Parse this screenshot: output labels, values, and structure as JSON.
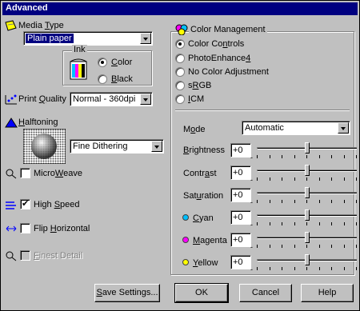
{
  "window": {
    "title": "Advanced"
  },
  "media_type": {
    "label_pre": "Media ",
    "label_ul": "T",
    "label_post": "ype",
    "selected": "Plain paper"
  },
  "ink": {
    "legend": "Ink",
    "options": [
      {
        "pre": "",
        "ul": "C",
        "post": "olor",
        "selected": true
      },
      {
        "pre": "",
        "ul": "B",
        "post": "lack",
        "selected": false
      }
    ]
  },
  "print_quality": {
    "label_pre": "Print ",
    "label_ul": "Q",
    "label_post": "uality",
    "selected": "Normal - 360dpi"
  },
  "halftoning": {
    "label_pre": "",
    "label_ul": "H",
    "label_post": "alftoning",
    "selected": "Fine Dithering"
  },
  "checkboxes": [
    {
      "pre": "Micro",
      "ul": "W",
      "post": "eave",
      "checked": false,
      "disabled": false
    },
    {
      "pre": "High ",
      "ul": "S",
      "post": "peed",
      "checked": true,
      "disabled": false
    },
    {
      "pre": "Flip ",
      "ul": "H",
      "post": "orizontal",
      "checked": false,
      "disabled": false
    },
    {
      "pre": "",
      "ul": "F",
      "post": "inest Detail",
      "checked": false,
      "disabled": true
    }
  ],
  "color_management": {
    "legend": "Color Management",
    "options": [
      {
        "pre": "Color Co",
        "ul": "n",
        "post": "trols",
        "selected": true
      },
      {
        "pre": "PhotoEnhance",
        "ul": "4",
        "post": "",
        "selected": false
      },
      {
        "pre": "No Color Adjustment",
        "ul": "",
        "post": "",
        "selected": false
      },
      {
        "pre": "s",
        "ul": "R",
        "post": "GB",
        "selected": false
      },
      {
        "pre": "",
        "ul": "I",
        "post": "CM",
        "selected": false
      }
    ],
    "mode": {
      "label_pre": "M",
      "label_ul": "o",
      "label_post": "de",
      "selected": "Automatic"
    },
    "sliders": [
      {
        "pre": "",
        "ul": "B",
        "post": "rightness",
        "value": "+0",
        "level": 0.5,
        "dot": null
      },
      {
        "pre": "Contr",
        "ul": "a",
        "post": "st",
        "value": "+0",
        "level": 0.5,
        "dot": null
      },
      {
        "pre": "Sat",
        "ul": "u",
        "post": "ration",
        "value": "+0",
        "level": 0.5,
        "dot": null
      },
      {
        "pre": "",
        "ul": "C",
        "post": "yan",
        "value": "+0",
        "level": 0.5,
        "dot": "#00c0ff"
      },
      {
        "pre": "",
        "ul": "M",
        "post": "agenta",
        "value": "+0",
        "level": 0.5,
        "dot": "#ff00ff"
      },
      {
        "pre": "",
        "ul": "Y",
        "post": "ellow",
        "value": "+0",
        "level": 0.5,
        "dot": "#ffff00"
      }
    ],
    "minus_label": "-",
    "plus_label": "+"
  },
  "buttons": {
    "save_settings": {
      "pre": "",
      "ul": "S",
      "post": "ave Settings..."
    },
    "ok": "OK",
    "cancel": "Cancel",
    "help": "Help"
  }
}
